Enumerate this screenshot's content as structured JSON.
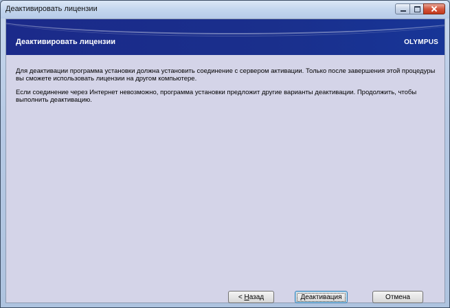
{
  "window": {
    "title": "Деактивировать лицензии"
  },
  "banner": {
    "title": "Деактивировать лицензии",
    "logo_text": "OLYMPUS"
  },
  "content": {
    "paragraph_1": "Для деактивации программа установки должна установить соединение с сервером активации. Только после завершения этой процедуры вы сможете использовать лицензии на другом компьютере.",
    "paragraph_2": "Если соединение через Интернет невозможно, программа установки предложит другие варианты деактивации. Продолжить, чтобы выполнить деактивацию."
  },
  "buttons": {
    "back_prefix": "< ",
    "back_accel": "Н",
    "back_rest": "азад",
    "deactivate_accel": "Д",
    "deactivate_rest": "еактивация",
    "cancel": "Отмена"
  },
  "colors": {
    "banner": "#1a2f8c",
    "client_bg": "#d4d4e8",
    "close_button": "#d3573e"
  }
}
